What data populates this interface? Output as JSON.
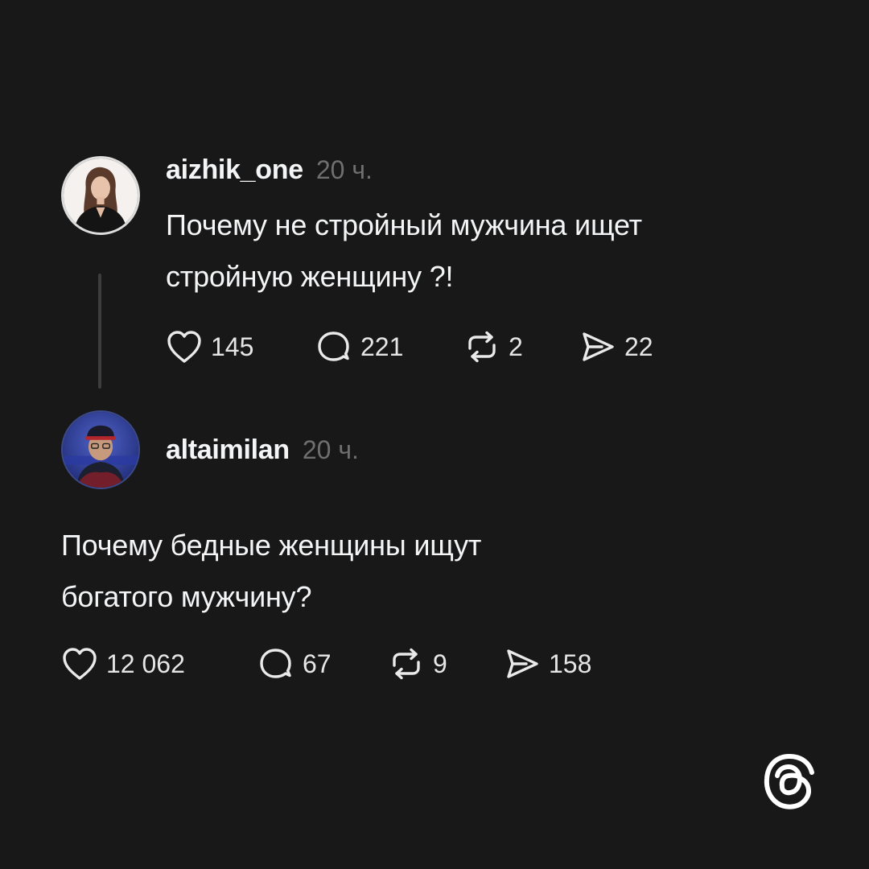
{
  "posts": [
    {
      "username": "aizhik_one",
      "timestamp": "20 ч.",
      "text_lines": [
        "Почему не стройный мужчина ищет",
        "стройную женщину ?!"
      ],
      "actions": {
        "likes": "145",
        "replies": "221",
        "reposts": "2",
        "shares": "22"
      }
    },
    {
      "username": "altaimilan",
      "timestamp": "20 ч.",
      "text_lines": [
        "Почему бедные женщины ищут",
        "богатого мужчину?"
      ],
      "actions": {
        "likes": "12 062",
        "replies": "67",
        "reposts": "9",
        "shares": "158"
      }
    }
  ],
  "icons": {
    "like": "heart-icon",
    "reply": "comment-bubble-icon",
    "repost": "repost-arrows-icon",
    "share": "send-icon",
    "brand": "threads-logo"
  },
  "colors": {
    "background": "#181818",
    "primary_text": "#f3f5f7",
    "secondary_text": "#6f6f6f",
    "thread_line": "#3d3d3d"
  }
}
